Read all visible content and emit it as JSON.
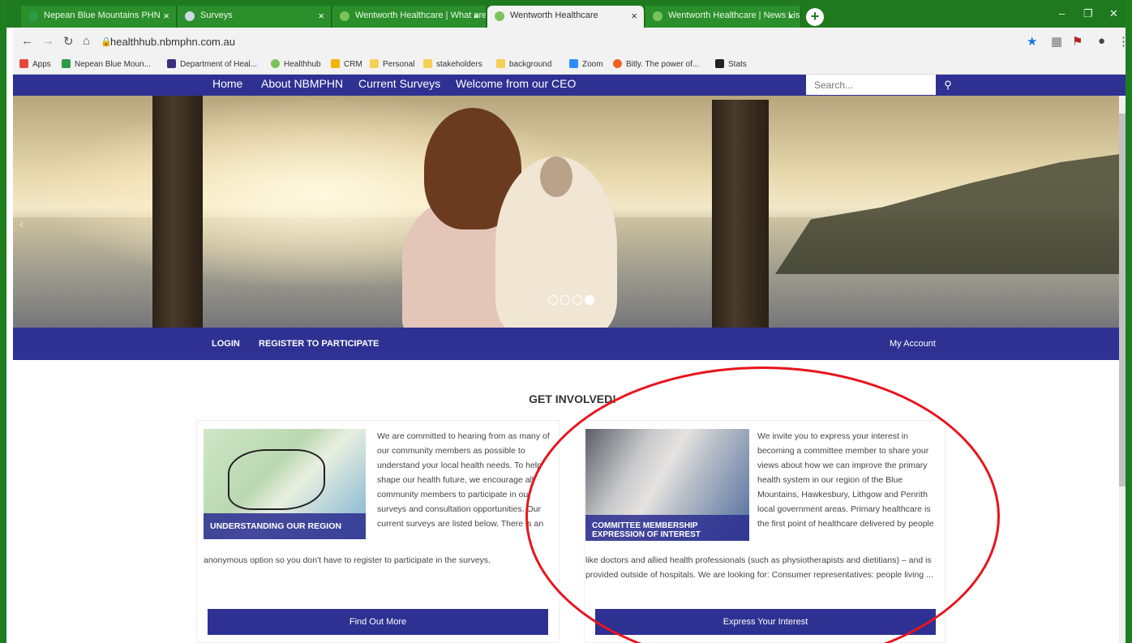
{
  "browser": {
    "tabs": [
      {
        "label": "Nepean Blue Mountains PHN"
      },
      {
        "label": "Surveys"
      },
      {
        "label": "Wentworth Healthcare | What are"
      },
      {
        "label": "Wentworth Healthcare"
      },
      {
        "label": "Wentworth Healthcare | News Lis"
      }
    ],
    "tab_close": "×",
    "new_tab": "+",
    "window_controls": [
      "–",
      "❐",
      "✕"
    ],
    "url": "healthhub.nbmphn.com.au",
    "bookmarks": [
      {
        "label": "Apps",
        "color": "#e8453c"
      },
      {
        "label": "Nepean Blue Moun...",
        "color": "#2e9b4a"
      },
      {
        "label": "Department of Heal...",
        "color": "#3a2f7d"
      },
      {
        "label": "Healthhub",
        "color": "#7ac35b"
      },
      {
        "label": "CRM",
        "color": "#f2b400"
      },
      {
        "label": "Personal",
        "color": "#f6cf55"
      },
      {
        "label": "stakeholders",
        "color": "#f6cf55"
      },
      {
        "label": "background",
        "color": "#f6cf55"
      },
      {
        "label": "Zoom",
        "color": "#2d8cff"
      },
      {
        "label": "Bitly. The power of...",
        "color": "#ee6123"
      },
      {
        "label": "Stats",
        "color": "#222222"
      }
    ]
  },
  "site_nav": {
    "items": [
      "Home",
      "About NBMPHN",
      "Current Surveys",
      "Welcome from our CEO"
    ],
    "search_placeholder": "Search..."
  },
  "hero": {
    "slide_count": 4,
    "active_slide": 4
  },
  "account_bar": {
    "login": "LOGIN",
    "register": "REGISTER TO PARTICIPATE",
    "my_account": "My Account"
  },
  "main": {
    "heading": "GET INVOLVED!",
    "cards": [
      {
        "caption": "UNDERSTANDING OUR REGION",
        "text": "We are committed to hearing from as many of our community members as possible to understand your local health needs. To help shape our health future, we encourage all community members to participate in our surveys and consultation opportunities. Our current surveys are listed below. There is an anonymous option so you don't have to register to participate in the surveys.",
        "button": "Find Out More"
      },
      {
        "caption_line1": "COMMITTEE MEMBERSHIP",
        "caption_line2": "EXPRESSION OF INTEREST",
        "text": "We invite you to express your interest in becoming a committee member to share your views about how we can improve the primary health system in our region of the Blue Mountains, Hawkesbury, Lithgow and Penrith local government areas. Primary healthcare is the first point of healthcare delivered by people like doctors and allied health professionals (such as physiotherapists and dietitians) – and is provided outside of hospitals. We are looking for: Consumer representatives: people living ...",
        "button": "Express Your Interest"
      }
    ]
  },
  "colors": {
    "brand": "#2e3192",
    "browser_frame": "#1f7a1f",
    "annotation": "#e8141d"
  }
}
